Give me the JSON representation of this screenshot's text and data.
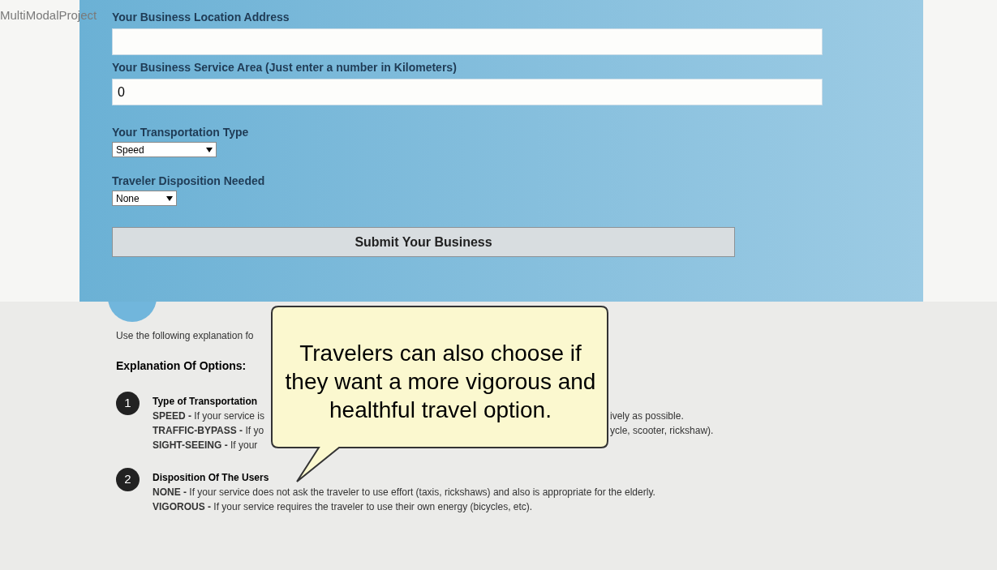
{
  "window": {
    "title": "MultiModalProject"
  },
  "form": {
    "fields": [
      {
        "kind": "text",
        "label": "Your Business Location Address"
      },
      {
        "kind": "text",
        "label": "Your Business Service Area (Just enter a number in Kilometers)",
        "value": "0"
      },
      {
        "kind": "select",
        "label": "Your Transportation Type",
        "value": "Speed"
      },
      {
        "kind": "select",
        "label": "Traveler Disposition Needed",
        "value": "None"
      }
    ],
    "submit": "Submit Your Business"
  },
  "explanation": {
    "intro": "Use the following explanation fo",
    "heading": "Explanation Of Options:",
    "sections": [
      {
        "number": "1",
        "title": "Type of Transportation",
        "lines": [
          {
            "left": "**SPEED -** If your service is",
            "right": "ively as possible."
          },
          {
            "left": "**TRAFFIC-BYPASS -** If yo",
            "right": "ycle, scooter, rickshaw)."
          },
          {
            "left": "**SIGHT-SEEING -** If your"
          }
        ]
      },
      {
        "number": "2",
        "title": "Disposition Of The Users",
        "lines": [
          {
            "left": "**NONE -** If your service does not ask the traveler to use effort (taxis, rickshaws) and also is appropriate for the elderly."
          },
          {
            "left": "**VIGOROUS -** If your service requires the traveler to use their own energy (bicycles, etc)."
          }
        ]
      }
    ]
  },
  "callout": {
    "text": "Travelers can also choose if they want a more vigorous and healthful travel option."
  }
}
